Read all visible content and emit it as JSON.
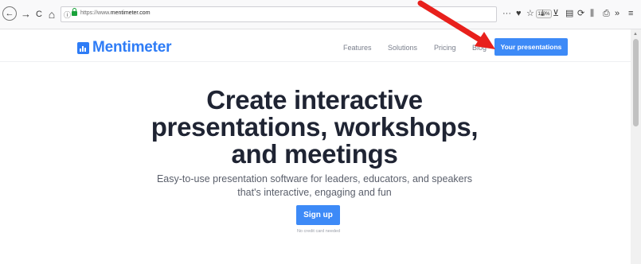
{
  "browser": {
    "url_prefix": "https://www.",
    "url_domain": "mentimeter.com",
    "zoom": "110%",
    "back_icon": "←",
    "forward_icon": "→",
    "reload_icon": "C",
    "home_icon": "⌂",
    "info_icon": "ⓘ",
    "more_icon": "···",
    "pocket_icon": "♥",
    "star_icon": "☆",
    "download_icon": "⤓",
    "sync_icon": "⊻",
    "reader_icon": "▤",
    "history_icon": "⟳",
    "library_icon": "⫼",
    "print_icon": "⎙",
    "overflow_icon": "»",
    "menu_icon": "≡"
  },
  "site": {
    "logo_text": "Mentimeter",
    "nav": [
      "Features",
      "Solutions",
      "Pricing",
      "Blog"
    ],
    "cta_label": "Your presentations"
  },
  "hero": {
    "title_line1": "Create interactive",
    "title_line2": "presentations, workshops,",
    "title_line3": "and meetings",
    "subtitle_line1": "Easy-to-use presentation software for leaders, educators, and speakers",
    "subtitle_line2": "that's interactive, engaging and fun",
    "signup_label": "Sign up",
    "note": "No credit card needed"
  },
  "colors": {
    "brand": "#2e7cf6",
    "button": "#3d8af7",
    "annotation_arrow": "#e8201c"
  }
}
